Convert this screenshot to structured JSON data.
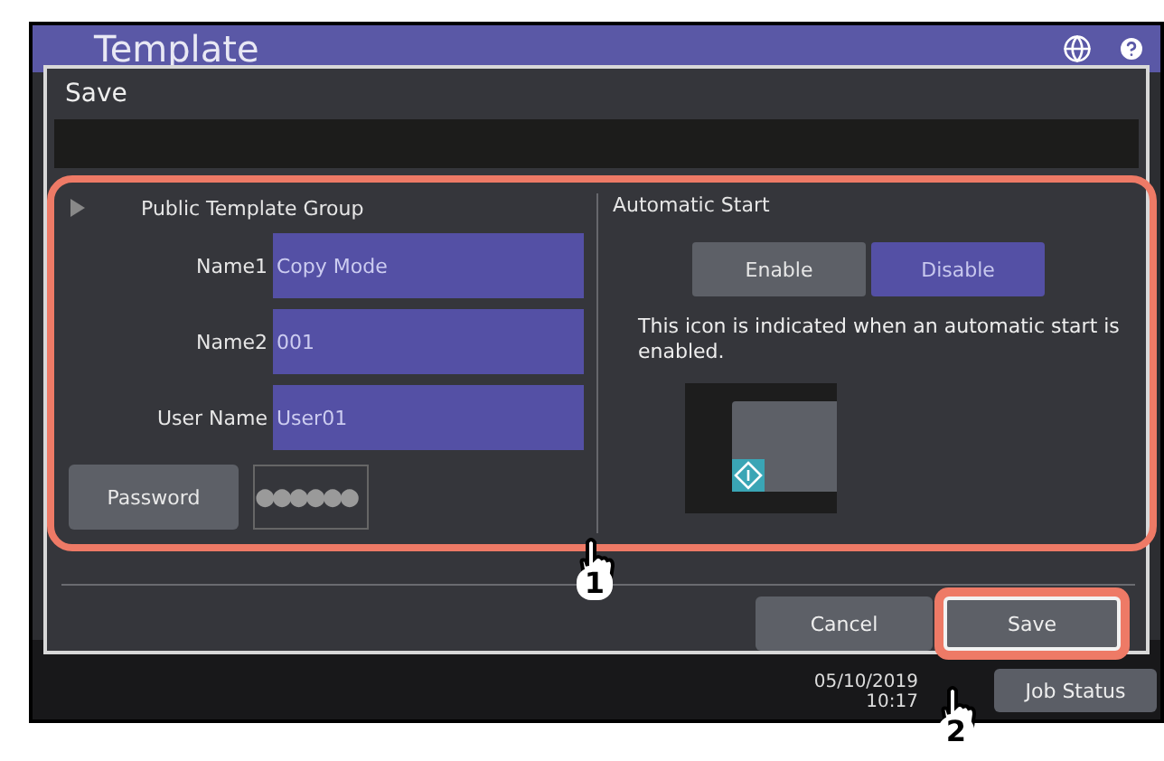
{
  "screen": {
    "title": "Template",
    "date": "05/10/2019",
    "time": "10:17",
    "job_status_button": "Job Status"
  },
  "dialog": {
    "title": "Save",
    "group": {
      "label": "Public Template Group",
      "expanded": false
    },
    "fields": [
      {
        "label": "Name1",
        "value": "Copy Mode"
      },
      {
        "label": "Name2",
        "value": "001"
      },
      {
        "label": "User Name",
        "value": "User01"
      }
    ],
    "password": {
      "button": "Password",
      "value": "●●●●●●"
    },
    "automatic_start": {
      "title": "Automatic Start",
      "note": "This icon is indicated when an automatic start is enabled.",
      "options": [
        {
          "label": "Enable",
          "selected": false
        },
        {
          "label": "Disable",
          "selected": true
        }
      ]
    },
    "buttons": [
      {
        "label": "Cancel",
        "highlighted": false
      },
      {
        "label": "Save",
        "highlighted": true
      }
    ]
  },
  "callouts": [
    "1",
    "2"
  ]
}
